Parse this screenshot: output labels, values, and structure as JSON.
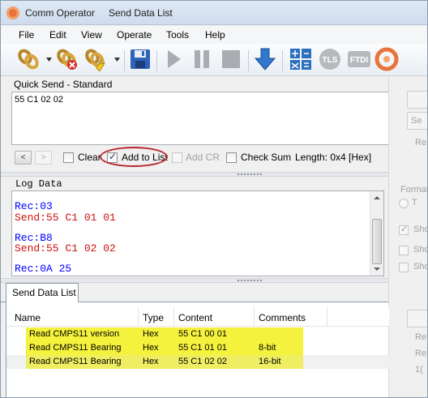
{
  "window": {
    "app_title": "Comm Operator",
    "doc_title": "Send Data List"
  },
  "menu": [
    "File",
    "Edit",
    "View",
    "Operate",
    "Tools",
    "Help"
  ],
  "toolbar": {
    "icons": [
      "connect-icon",
      "disconnect-icon",
      "reconnect-icon",
      "save-icon",
      "play-icon",
      "pause-icon",
      "stop-icon",
      "download-icon",
      "calculator-icon",
      "tls-icon",
      "ftdi-icon",
      "app-logo-icon"
    ],
    "tls_text": "TLS",
    "ftdi_text": "FTDI"
  },
  "quick_send": {
    "label": "Quick Send - Standard",
    "value": "55 C1 02 02",
    "prev_label": "<",
    "next_label": ">",
    "clear_label": "Clear",
    "add_to_list_label": "Add to List",
    "add_cr_label": "Add CR",
    "check_sum_label": "Check Sum",
    "length_text": "Length: 0x4 [Hex]",
    "clear_checked": false,
    "add_to_list_checked": true,
    "add_cr_checked": false,
    "check_sum_checked": false
  },
  "log": {
    "label": "Log Data",
    "lines": [
      {
        "text": "Rec:03",
        "kind": "rec"
      },
      {
        "text": "Send:55 C1 01 01",
        "kind": "send"
      },
      {
        "text": "",
        "kind": "blank"
      },
      {
        "text": "Rec:B8",
        "kind": "rec"
      },
      {
        "text": "Send:55 C1 02 02",
        "kind": "send"
      },
      {
        "text": "",
        "kind": "blank"
      },
      {
        "text": "Rec:0A 25",
        "kind": "rec"
      }
    ]
  },
  "right_panel": {
    "format_label": "Format",
    "radio_text": "T",
    "btn1_text": "Se",
    "text_r1": "Re",
    "shows": [
      "Sho",
      "Sho",
      "Sho"
    ],
    "text_r2": "Re",
    "text_r3": "Re",
    "text_r4": "1("
  },
  "send_list": {
    "tab_label": "Send Data List",
    "columns": [
      "Name",
      "Type",
      "Content",
      "Comments"
    ],
    "rows": [
      {
        "name": "Read CMPS11 version",
        "type": "Hex",
        "content": "55 C1 00 01",
        "comments": ""
      },
      {
        "name": "Read CMPS11 Bearing",
        "type": "Hex",
        "content": "55 C1 01 01",
        "comments": "8-bit"
      },
      {
        "name": "Read CMPS11 Bearing",
        "type": "Hex",
        "content": "55 C1 02 02",
        "comments": "16-bit"
      }
    ],
    "highlight_color": "#f4f23c"
  },
  "colors": {
    "rec": "#0000ff",
    "send": "#d01010",
    "annotation": "#b8262c"
  }
}
